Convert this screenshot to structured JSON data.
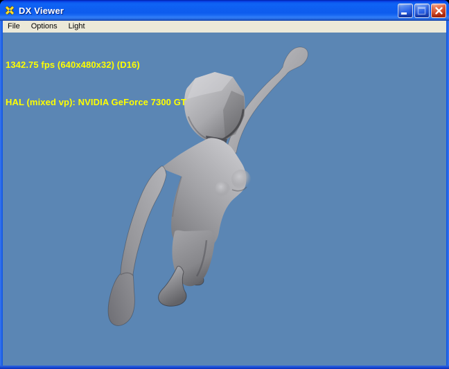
{
  "window": {
    "title": "DX Viewer",
    "titlebar_color": "#0d5ef0",
    "border_color": "#0b51dd"
  },
  "menu": {
    "items": [
      {
        "label": "File"
      },
      {
        "label": "Options"
      },
      {
        "label": "Light"
      }
    ]
  },
  "hud": {
    "line1": "1342.75 fps (640x480x32) (D16)",
    "line2": "HAL (mixed vp): NVIDIA GeForce 7300 GT",
    "text_color": "#ffff00",
    "fps": "1342.75",
    "resolution": "640x480x32",
    "depth_format": "D16",
    "device": "HAL (mixed vp)",
    "gpu": "NVIDIA GeForce 7300 GT"
  },
  "viewport": {
    "background_color": "#5b86b4",
    "model": {
      "description": "low-poly gray female humanoid figure, right arm raised up-right, left arm hanging down, legs bent mid-stride",
      "base_color": "#a8a8ac"
    }
  },
  "icons": {
    "app": "directx-logo-icon",
    "minimize": "minimize-icon",
    "maximize": "maximize-icon",
    "close": "close-icon"
  }
}
